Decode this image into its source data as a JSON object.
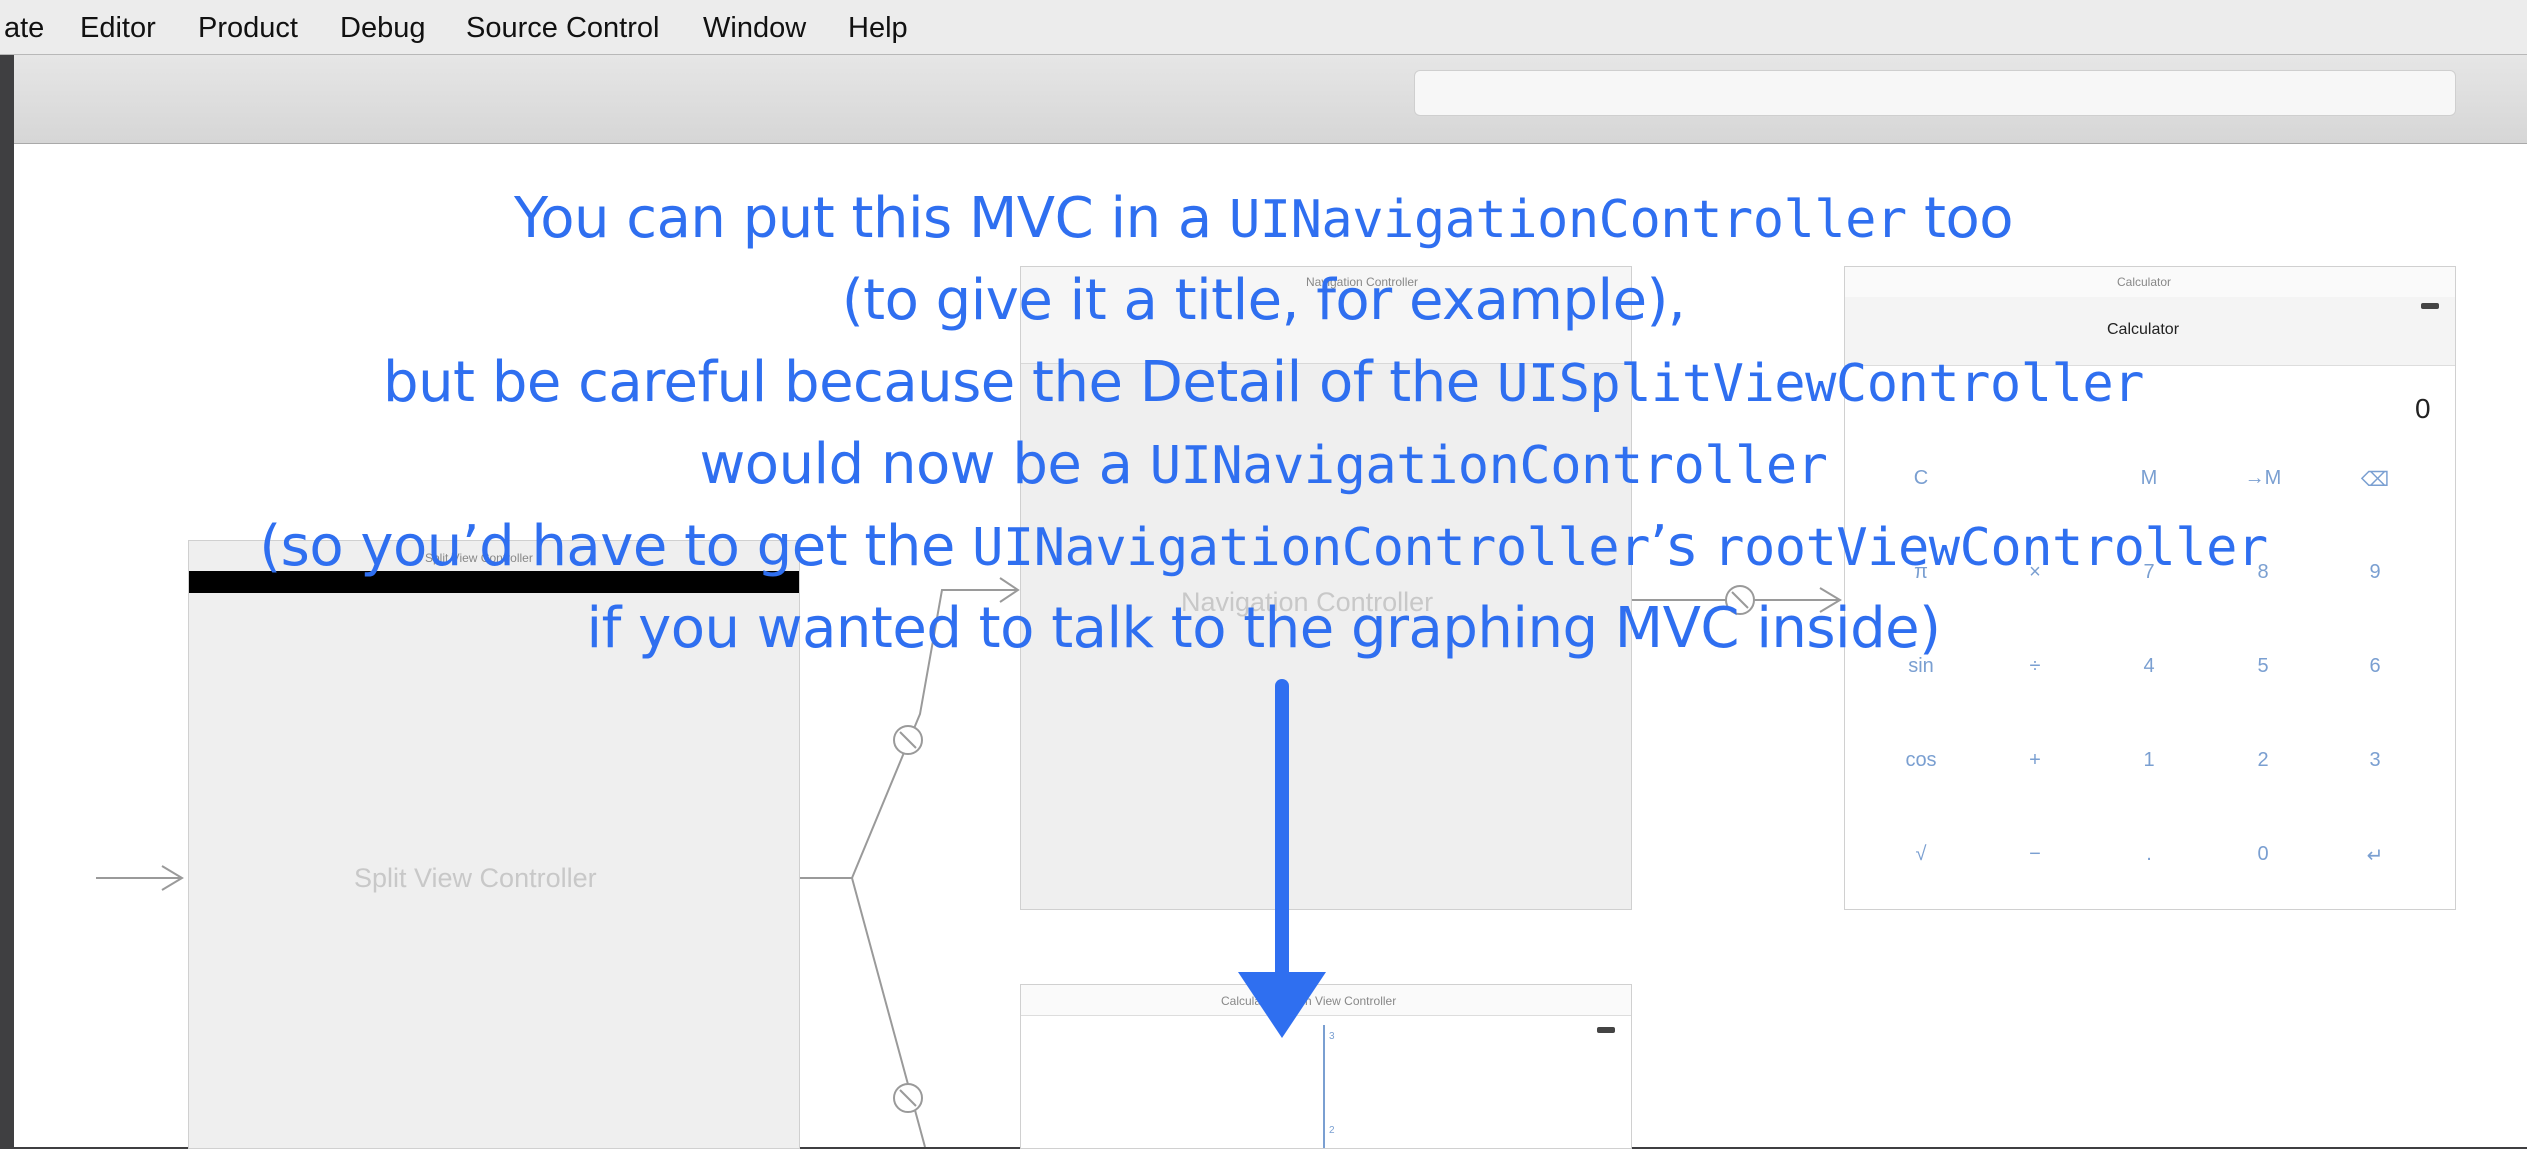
{
  "menubar": {
    "items": [
      "ate",
      "Editor",
      "Product",
      "Debug",
      "Source Control",
      "Window",
      "Help"
    ]
  },
  "storyboard": {
    "split_view": {
      "small_title": "Split View Controller",
      "label": "Split View Controller"
    },
    "navigation": {
      "small_title": "Navigation Controller",
      "label": "Navigation Controller"
    },
    "calculator": {
      "small_title": "Calculator",
      "nav_title": "Calculator",
      "display_value": "0",
      "buttons": [
        [
          "C",
          "",
          "M",
          "→M",
          "⌫"
        ],
        [
          "π",
          "×",
          "7",
          "8",
          "9"
        ],
        [
          "sin",
          "÷",
          "4",
          "5",
          "6"
        ],
        [
          "cos",
          "+",
          "1",
          "2",
          "3"
        ],
        [
          "√",
          "−",
          ".",
          "0",
          "↵"
        ]
      ]
    },
    "graph": {
      "small_title": "Calculator Graph View Controller",
      "axis_ticks": [
        "3",
        "2"
      ]
    }
  },
  "annotation": {
    "line1_a": "You can put this MVC in a ",
    "line1_b": "UINavigationController",
    "line1_c": " too",
    "line2": "(to give it a title, for example),",
    "line3_a": "but be careful because the Detail of the ",
    "line3_b": "UISplitViewController",
    "line4_a": "would now be a ",
    "line4_b": "UINavigationController",
    "line5_a": "(so you’d have to get the ",
    "line5_b": "UINavigationController",
    "line5_c": "’s ",
    "line5_d": "rootViewController",
    "line6": "if you wanted to talk to the graphing MVC inside)"
  },
  "colors": {
    "annotation": "#2f6ff0",
    "calc_buttons": "#7a9fd1"
  }
}
